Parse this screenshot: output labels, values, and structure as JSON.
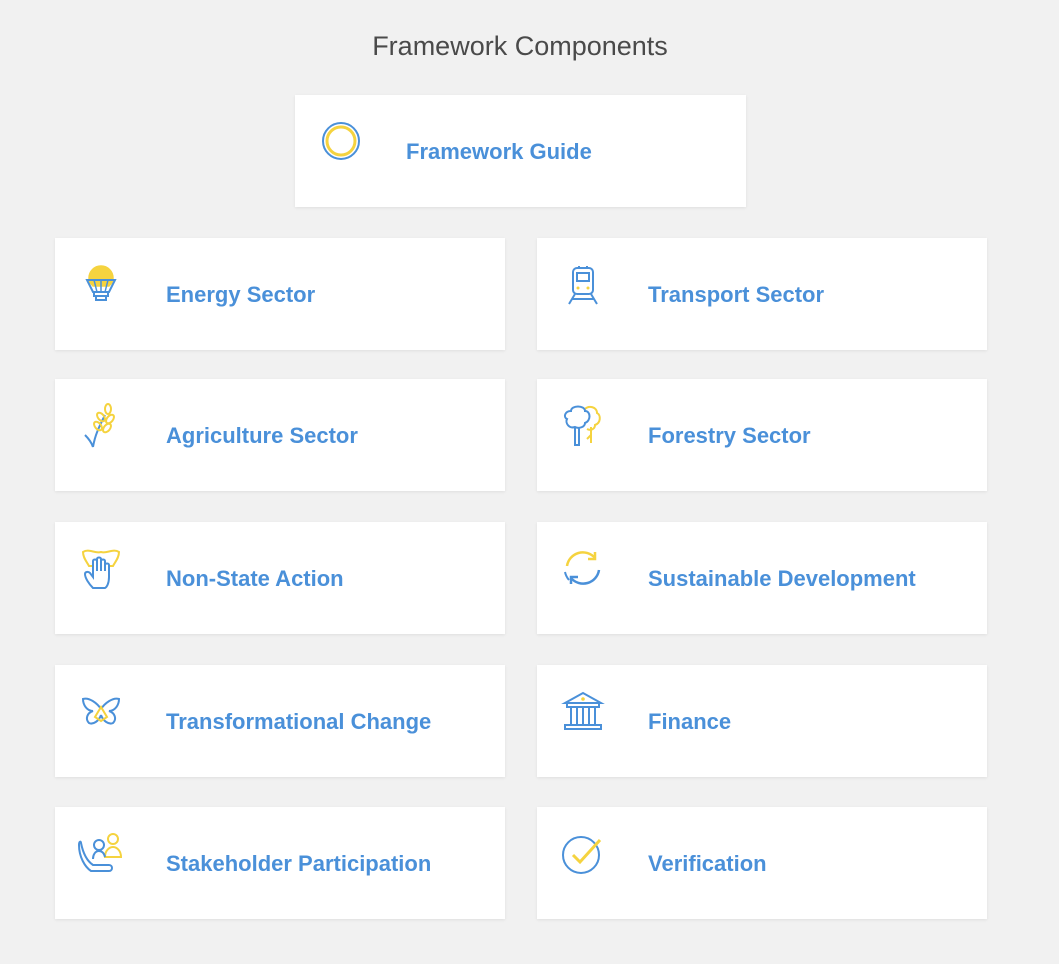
{
  "page": {
    "title": "Framework Components"
  },
  "colors": {
    "background": "#f1f1f1",
    "card": "#ffffff",
    "label": "#4a90d9",
    "icon_blue": "#4a90d9",
    "icon_yellow": "#f5d33f"
  },
  "guide": {
    "label": "Framework Guide",
    "icon": "ring-icon"
  },
  "components": [
    {
      "label": "Energy Sector",
      "icon": "lightbulb-icon"
    },
    {
      "label": "Transport Sector",
      "icon": "train-icon"
    },
    {
      "label": "Agriculture Sector",
      "icon": "wheat-icon"
    },
    {
      "label": "Forestry Sector",
      "icon": "tree-icon"
    },
    {
      "label": "Non-State Action",
      "icon": "raised-hand-icon"
    },
    {
      "label": "Sustainable Development",
      "icon": "recycle-arrows-icon"
    },
    {
      "label": "Transformational Change",
      "icon": "butterfly-icon"
    },
    {
      "label": "Finance",
      "icon": "bank-building-icon"
    },
    {
      "label": "Stakeholder Participation",
      "icon": "people-icon"
    },
    {
      "label": "Verification",
      "icon": "checkmark-circle-icon"
    }
  ]
}
